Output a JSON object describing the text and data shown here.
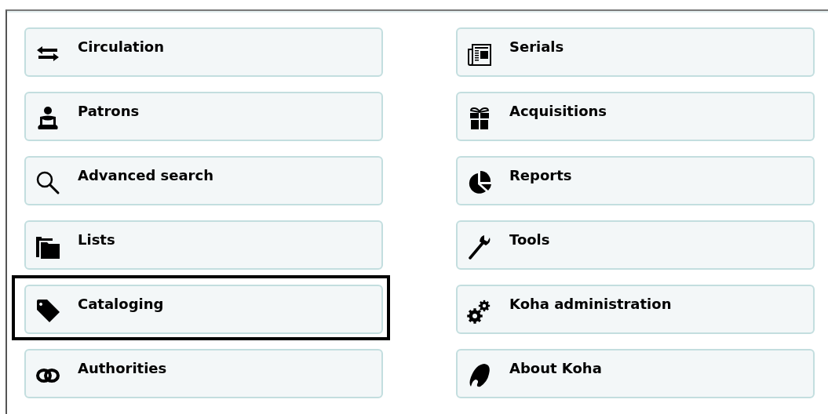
{
  "columns": [
    {
      "items": [
        {
          "label": "Circulation",
          "highlighted": false
        },
        {
          "label": "Patrons",
          "highlighted": false
        },
        {
          "label": "Advanced search",
          "highlighted": false
        },
        {
          "label": "Lists",
          "highlighted": false
        },
        {
          "label": "Cataloging",
          "highlighted": true
        },
        {
          "label": "Authorities",
          "highlighted": false
        }
      ]
    },
    {
      "items": [
        {
          "label": "Serials",
          "highlighted": false
        },
        {
          "label": "Acquisitions",
          "highlighted": false
        },
        {
          "label": "Reports",
          "highlighted": false
        },
        {
          "label": "Tools",
          "highlighted": false
        },
        {
          "label": "Koha administration",
          "highlighted": false
        },
        {
          "label": "About Koha",
          "highlighted": false
        }
      ]
    }
  ]
}
